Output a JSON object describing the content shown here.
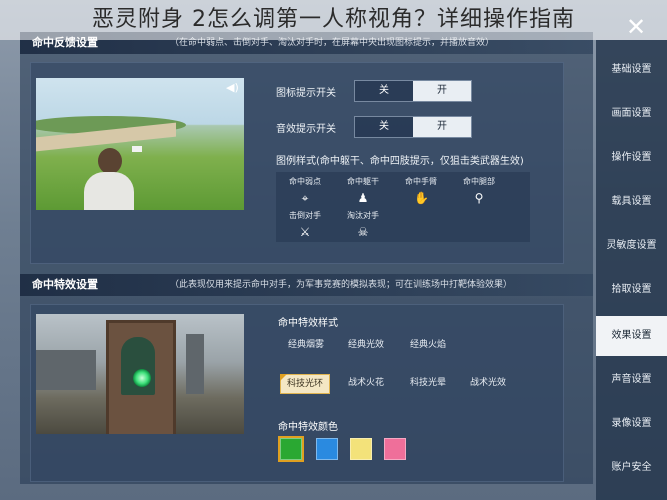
{
  "banner": {
    "title": "恶灵附身 2怎么调第一人称视角？详细操作指南"
  },
  "sections": [
    {
      "title": "命中反馈设置",
      "note": "（在命中弱点、击倒对手、淘汰对手时，在屏幕中央出现图标提示，并播放音效）"
    },
    {
      "title": "命中特效设置",
      "note": "（此表现仅用来提示命中对手，为军事竞赛的模拟表现；可在训练场中打靶体验效果）"
    }
  ],
  "feedback": {
    "icon_toggle_label": "图标提示开关",
    "sound_toggle_label": "音效提示开关",
    "off_label": "关",
    "on_label": "开",
    "icon_toggle_selected": "开",
    "sound_toggle_selected": "开",
    "legend_title": "图例样式(命中躯干、命中四肢提示，仅狙击类武器生效)",
    "hit_items": [
      {
        "label": "命中弱点",
        "icon": "crosshair-icon"
      },
      {
        "label": "命中躯干",
        "icon": "torso-hit-icon"
      },
      {
        "label": "命中手臂",
        "icon": "arm-hit-icon"
      },
      {
        "label": "命中腿部",
        "icon": "leg-hit-icon"
      },
      {
        "label": "击倒对手",
        "icon": "knockdown-icon"
      },
      {
        "label": "淘汰对手",
        "icon": "eliminate-icon"
      }
    ]
  },
  "effects": {
    "style_title": "命中特效样式",
    "styles": [
      "经典烟雾",
      "经典光效",
      "经典火焰",
      "科技光环",
      "战术火花",
      "科技光晕",
      "战术光效"
    ],
    "selected_style": "科技光环",
    "color_title": "命中特效颜色",
    "colors": [
      "#2aa832",
      "#2a8ae0",
      "#f3e27a",
      "#ef6f9a"
    ],
    "selected_color": "#2aa832"
  },
  "sidebar": {
    "items": [
      "基础设置",
      "画面设置",
      "操作设置",
      "载具设置",
      "灵敏度设置",
      "拾取设置",
      "效果设置",
      "声音设置",
      "录像设置",
      "账户安全"
    ],
    "active": "效果设置"
  }
}
